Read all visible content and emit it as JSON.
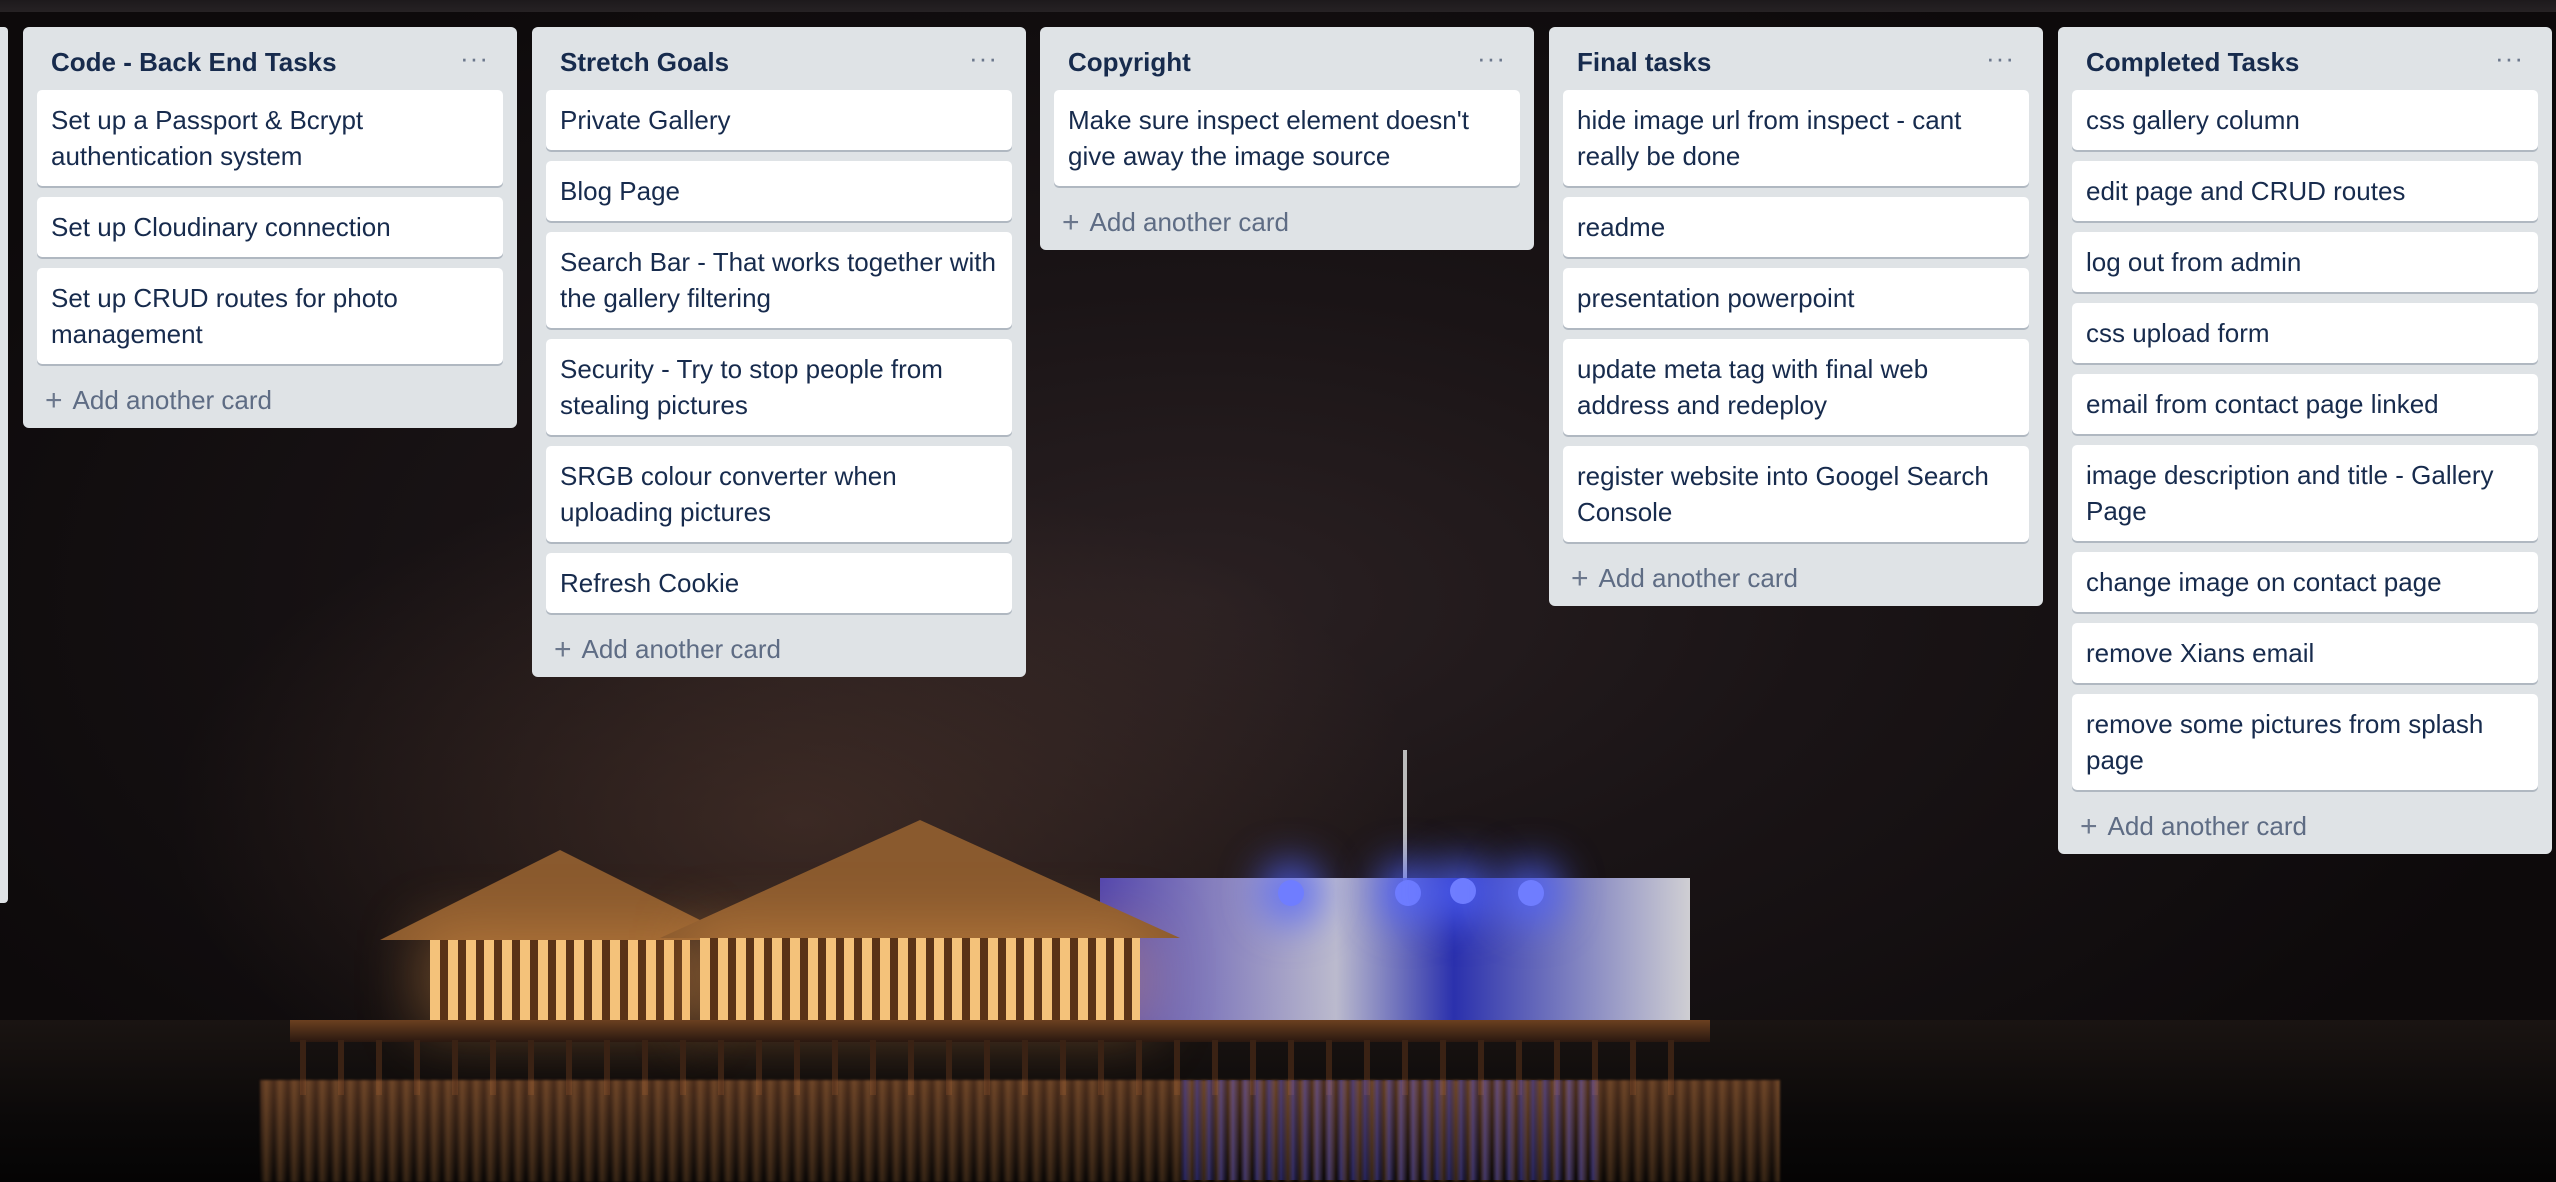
{
  "lists": [
    {
      "title": "Code - Back End Tasks",
      "menu": "···",
      "cards": [
        "Set up a Passport & Bcrypt authentication system",
        "Set up Cloudinary connection",
        "Set up CRUD routes for photo management"
      ],
      "add_label": "Add another card"
    },
    {
      "title": "Stretch Goals",
      "menu": "···",
      "cards": [
        "Private Gallery",
        "Blog Page",
        "Search Bar - That works together with the gallery filtering",
        "Security - Try to stop people from stealing pictures",
        "SRGB colour converter when uploading pictures",
        "Refresh Cookie"
      ],
      "add_label": "Add another card"
    },
    {
      "title": "Copyright",
      "menu": "···",
      "cards": [
        "Make sure inspect element doesn't give away the image source"
      ],
      "add_label": "Add another card"
    },
    {
      "title": "Final tasks",
      "menu": "···",
      "cards": [
        "hide image url from inspect - cant really be done",
        "readme",
        "presentation powerpoint",
        "update meta tag with final web address and redeploy",
        "register website into Googel Search Console"
      ],
      "add_label": "Add another card"
    },
    {
      "title": "Completed Tasks",
      "menu": "···",
      "cards": [
        "css gallery column",
        "edit page and CRUD routes",
        "log out from admin",
        "css upload form",
        "email from contact page linked",
        "image description and title - Gallery Page",
        "change image on contact page",
        "remove Xians email",
        "remove some pictures from splash page"
      ],
      "add_label": "Add another card"
    }
  ],
  "icons": {
    "list_menu": "ellipsis-icon",
    "add": "plus-icon"
  }
}
